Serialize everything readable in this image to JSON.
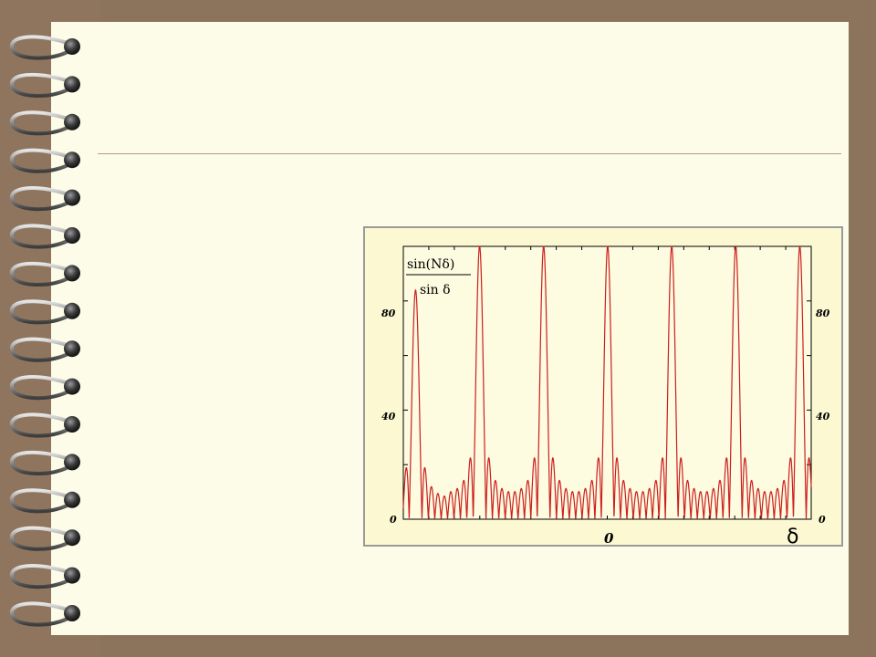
{
  "chart_data": {
    "type": "line",
    "ylabel_numerator": "sin(Nδ)",
    "ylabel_denominator": "sin δ",
    "xlabel_symbol": "δ",
    "x_tick_labels": [
      "0"
    ],
    "y_tick_labels": [
      "0",
      "40",
      "80"
    ],
    "ylim": [
      0,
      100
    ],
    "line_color": "#cc1f1f",
    "peak_heights": [
      84,
      100,
      100,
      100,
      100,
      100,
      100
    ],
    "grid": false
  },
  "colors": {
    "page": "#fcfce8",
    "plot_background": "#fbf8d2",
    "binder": "#8c735c"
  }
}
